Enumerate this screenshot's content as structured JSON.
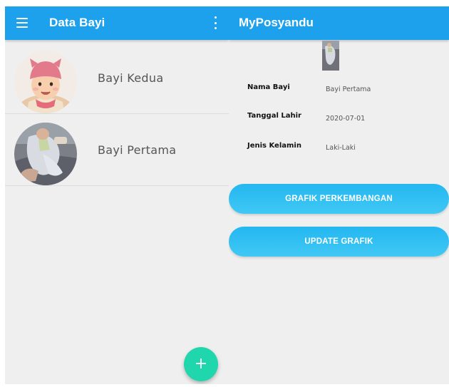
{
  "left_screen": {
    "appbar": {
      "title": "Data Bayi",
      "menu_icon": "hamburger-menu-icon",
      "more_icon": "more-vert-icon"
    },
    "babies": [
      {
        "name": "Bayi Kedua",
        "avatar": "baby-photo-pink-hat"
      },
      {
        "name": "Bayi Pertama",
        "avatar": "baby-photo-lying"
      }
    ],
    "fab": {
      "label": "+",
      "icon": "add-icon",
      "color": "#20d6ad"
    }
  },
  "right_screen": {
    "appbar": {
      "title": "MyPosyandu"
    },
    "thumbnail": "baby-photo-thumbnail",
    "details": [
      {
        "label": "Nama Bayi",
        "value": "Bayi Pertama"
      },
      {
        "label": "Tanggal Lahir",
        "value": "2020-07-01"
      },
      {
        "label": "Jenis Kelamin",
        "value": "Laki-Laki"
      }
    ],
    "buttons": {
      "grafik_perkembangan": "GRAFIK PERKEMBANGAN",
      "update_grafik": "UPDATE GRAFIK"
    }
  },
  "colors": {
    "appbar": "#1ea1ed",
    "background": "#efefef",
    "button": "#2ebcf2",
    "fab": "#20d6ad"
  }
}
